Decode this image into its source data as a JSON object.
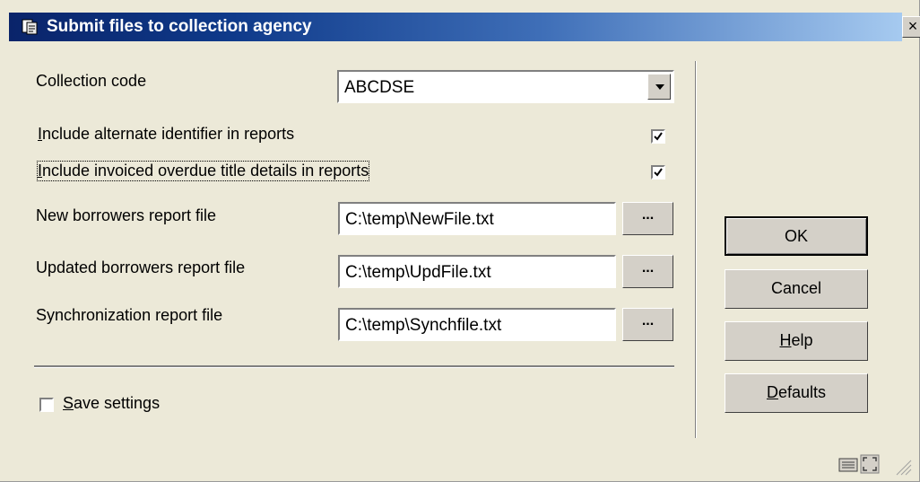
{
  "window": {
    "title": "Submit files to collection agency",
    "close_label": "×"
  },
  "form": {
    "collection_code": {
      "label": "Collection code",
      "value": "ABCDSE"
    },
    "include_alt_id": {
      "label": "Include alternate identifier in reports",
      "accel": "I",
      "rest": "nclude alternate identifier in reports",
      "checked": true
    },
    "include_invoiced": {
      "label": "Include invoiced overdue title details in reports",
      "accel": "I",
      "rest": "nclude invoiced overdue title details in reports",
      "checked": true
    },
    "new_borrowers": {
      "label": "New borrowers report file",
      "value": "C:\\temp\\NewFile.txt",
      "browse": "..."
    },
    "updated_borrowers": {
      "label": "Updated borrowers report file",
      "value": "C:\\temp\\UpdFile.txt",
      "browse": "..."
    },
    "sync_report": {
      "label": "Synchronization report file",
      "value": "C:\\temp\\Synchfile.txt",
      "browse": "..."
    },
    "save_settings": {
      "label": "Save settings",
      "accel": "S",
      "rest": "ave settings",
      "checked": false
    }
  },
  "buttons": {
    "ok": "OK",
    "cancel": "Cancel",
    "help_accel": "H",
    "help_rest": "elp",
    "defaults_accel": "D",
    "defaults_rest": "efaults"
  },
  "colors": {
    "title_start": "#0a246a",
    "title_end": "#a6caf0",
    "dialog_bg": "#ece9d8"
  }
}
